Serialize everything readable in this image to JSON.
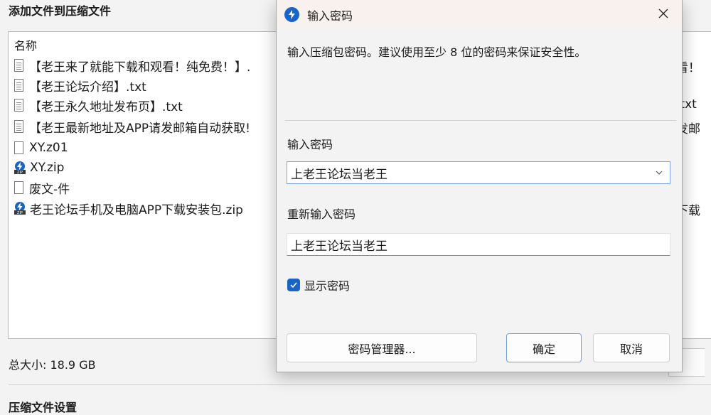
{
  "background": {
    "title": "添加文件到压缩文件",
    "column_header": "名称",
    "files": [
      {
        "name": "【老王来了就能下载和观看！纯免费！】.",
        "icon": "text-file-icon",
        "right_fragment": "看！"
      },
      {
        "name": "【老王论坛介绍】.txt",
        "icon": "text-file-icon",
        "right_fragment": ""
      },
      {
        "name": "【老王永久地址发布页】.txt",
        "icon": "text-file-icon",
        "right_fragment": ".txt"
      },
      {
        "name": "【老王最新地址及APP请发邮箱自动获取!",
        "icon": "text-file-icon",
        "right_fragment": "发邮"
      },
      {
        "name": "XY.z01",
        "icon": "blank-file-icon",
        "right_fragment": ""
      },
      {
        "name": "XY.zip",
        "icon": "zip-archive-icon",
        "right_fragment": ""
      },
      {
        "name": "废文-件",
        "icon": "blank-file-icon",
        "right_fragment": ""
      },
      {
        "name": "老王论坛手机及电脑APP下载安装包.zip",
        "icon": "zip-archive-icon",
        "right_fragment": "下载"
      }
    ],
    "total_size": "总大小: 18.9 GB",
    "bottom_section_cut": "压缩文件设置"
  },
  "dialog": {
    "title": "输入密码",
    "description": "输入压缩包密码。建议使用至少 8 位的密码来保证安全性。",
    "password_label": "输入密码",
    "password_value": "上老王论坛当老王",
    "reenter_label": "重新输入密码",
    "reenter_value": "上老王论坛当老王",
    "show_password_label": "显示密码",
    "show_password_checked": true,
    "password_manager_button": "密码管理器...",
    "ok_button": "确定",
    "cancel_button": "取消"
  },
  "colors": {
    "accent": "#1a64c8",
    "titlebar": "#f8f1ed",
    "window_bg": "#f3f3f3"
  }
}
